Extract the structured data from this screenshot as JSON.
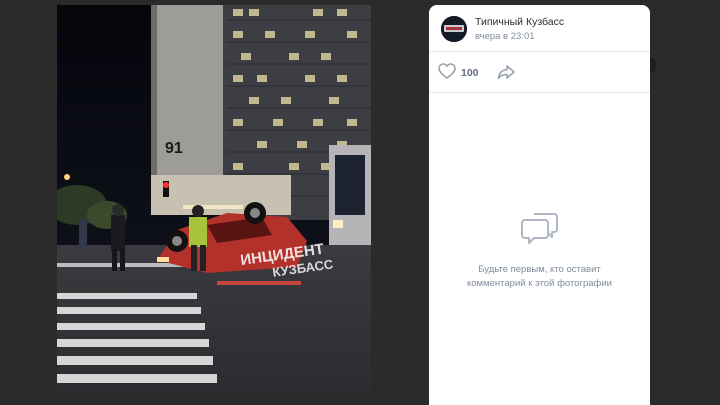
{
  "post": {
    "group_name": "Типичный Кузбасс",
    "time": "вчера в 23:01",
    "likes": "100"
  },
  "photo": {
    "watermark_line1": "ИНЦИДЕНТ",
    "watermark_line2": "КУЗБАСС",
    "building_number": "91"
  },
  "comments": {
    "empty_line1": "Будьте первым, кто оставит",
    "empty_line2": "комментарий к этой фотографии"
  },
  "icons": {
    "like": "heart-icon",
    "share": "share-arrow-icon",
    "comments": "comment-bubble-icon"
  },
  "colors": {
    "panel_bg": "#ffffff",
    "overlay_bg": "#2b2b2b",
    "muted_text": "#818c99",
    "icon_gray": "#aeb7c2"
  }
}
